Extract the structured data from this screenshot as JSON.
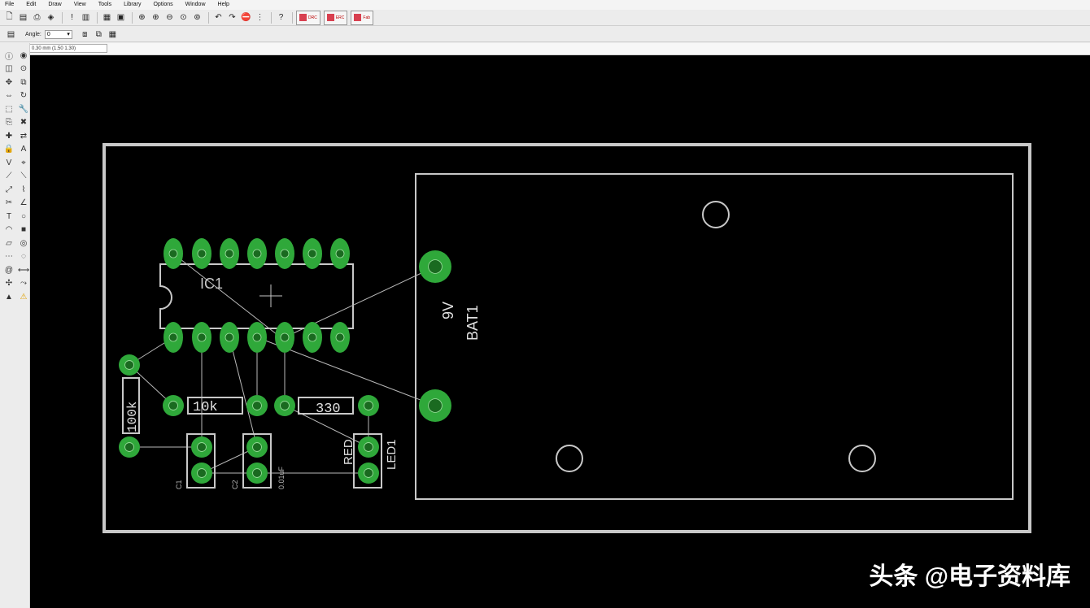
{
  "menu": [
    "File",
    "Edit",
    "Draw",
    "View",
    "Tools",
    "Library",
    "Options",
    "Window",
    "Help"
  ],
  "toolbar": {
    "icons": [
      "new-file-icon",
      "save-icon",
      "print-icon",
      "cam-icon",
      "script-icon",
      "ulp-icon",
      "board-icon",
      "library-icon",
      "zoom-fit-icon",
      "zoom-in-icon",
      "zoom-out-icon",
      "zoom-select-icon",
      "redraw-icon",
      "undo-icon",
      "redo-icon",
      "stop-icon",
      "go-icon",
      "help-icon"
    ],
    "buttons": [
      "DRC",
      "ERC",
      "Fab"
    ]
  },
  "params": {
    "angle_label": "Angle:",
    "angle_value": "0"
  },
  "coords": {
    "readout": "0.30 mm (1.50 1.30)"
  },
  "left_tools": [
    "info-icon",
    "show-icon",
    "display-icon",
    "mark-icon",
    "move-icon",
    "copy-icon",
    "mirror-icon",
    "rotate-icon",
    "group-icon",
    "change-icon",
    "paste-icon",
    "delete-icon",
    "add-icon",
    "replace-icon",
    "lock-icon",
    "name-icon",
    "value-icon",
    "smash-icon",
    "split-icon",
    "miter-icon",
    "optimize-icon",
    "route-icon",
    "ripup-icon",
    "wire-icon",
    "text-icon",
    "circle-icon",
    "arc-icon",
    "rect-icon",
    "polygon-icon",
    "via-icon",
    "signal-icon",
    "hole-icon",
    "attribute-icon",
    "dimension-icon",
    "ratsnest-icon",
    "autorouter-icon",
    "drc-icon",
    "errors-icon"
  ],
  "board": {
    "labels": {
      "ic1": "IC1",
      "bat_value": "9V",
      "bat_name": "BAT1",
      "r1_value": "10k",
      "r2_value": "100k",
      "r3_value": "330",
      "led_value": "RED",
      "led_name": "LED1",
      "c_label": "C2",
      "c_value": "0.01uF",
      "c1_label": "C1"
    }
  },
  "watermark": "头条 @电子资料库"
}
